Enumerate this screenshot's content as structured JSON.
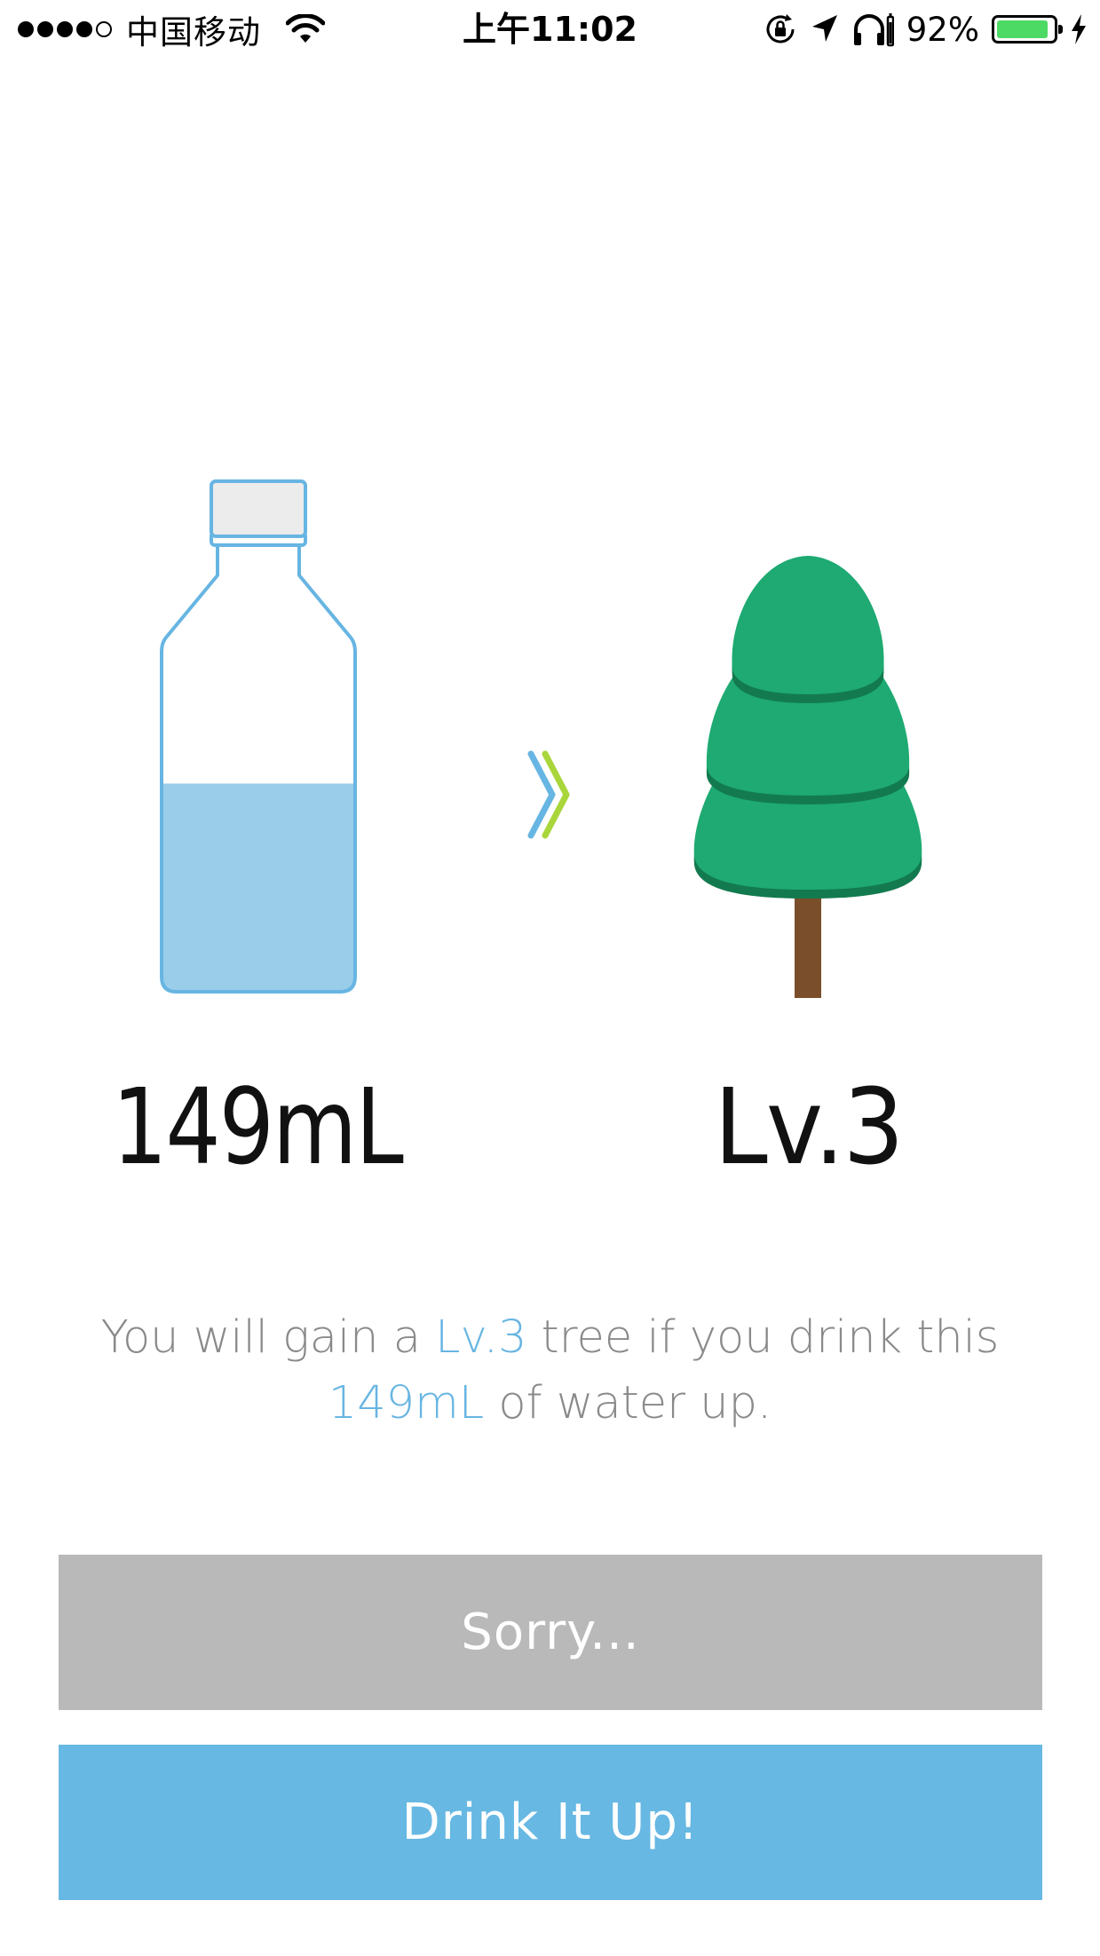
{
  "status_bar": {
    "carrier": "中国移动",
    "time": "上午11:02",
    "battery_percent": "92%",
    "battery_level": 0.92,
    "signal_strength": 4,
    "signal_max": 5
  },
  "illustration": {
    "bottle_fill_fraction": 0.5,
    "bottle_color": "#67b5e2",
    "water_color": "#9acdea",
    "cap_color": "#ececec",
    "tree_color": "#1eaa72",
    "tree_shadow_color": "#137a4f",
    "trunk_color": "#7a4e2a",
    "arrow_colors": [
      "#67b5e2",
      "#a9d63a"
    ]
  },
  "volume": "149mL",
  "level": "Lv.3",
  "message": {
    "prefix": "You will gain a ",
    "level": "Lv.3",
    "middle": " tree if you drink this",
    "volume": "149mL",
    "suffix": " of water up."
  },
  "buttons": {
    "sorry": "Sorry...",
    "drink": "Drink It Up!"
  },
  "colors": {
    "accent": "#67b5e2",
    "sorry_bg": "#b9b9b9",
    "drink_bg": "#67b8e3",
    "message_text": "#8a8a8a"
  }
}
